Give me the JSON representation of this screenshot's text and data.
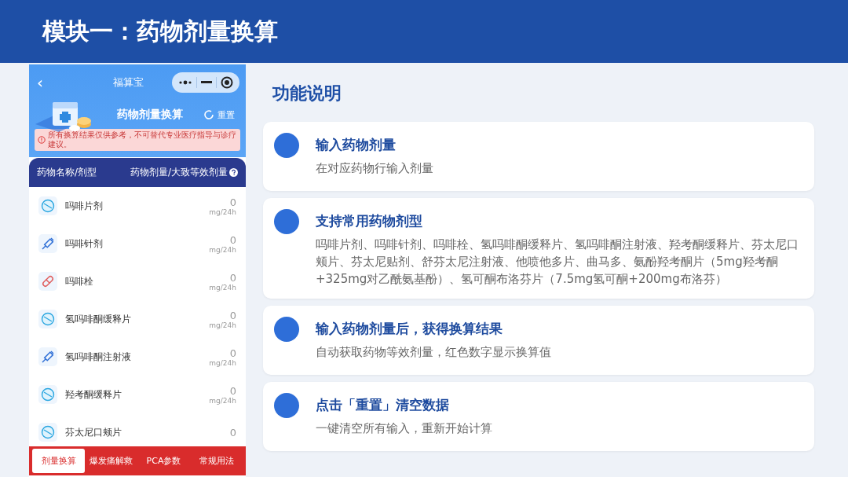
{
  "header": {
    "title": "模块一：药物剂量换算"
  },
  "phone": {
    "nav_title": "福算宝",
    "nav_back": "‹",
    "app_title": "药物剂量换算",
    "reset": "重置",
    "warning": "所有换算结果仅供参考，不可替代专业医疗指导与诊疗建议。",
    "columns": [
      "药物名称/剂型",
      "药物剂量/大致等效剂量"
    ],
    "rows": [
      {
        "kind": "tablet",
        "name": "吗啡片剂",
        "value": "0",
        "unit": "mg/24h"
      },
      {
        "kind": "injection",
        "name": "吗啡针剂",
        "value": "0",
        "unit": "mg/24h"
      },
      {
        "kind": "capsule",
        "name": "吗啡栓",
        "value": "0",
        "unit": "mg/24h"
      },
      {
        "kind": "tablet",
        "name": "氢吗啡酮缓释片",
        "value": "0",
        "unit": "mg/24h"
      },
      {
        "kind": "injection",
        "name": "氢吗啡酮注射液",
        "value": "0",
        "unit": "mg/24h"
      },
      {
        "kind": "tablet",
        "name": "羟考酮缓释片",
        "value": "0",
        "unit": "mg/24h"
      },
      {
        "kind": "tablet",
        "name": "芬太尼口颊片",
        "value": "0"
      }
    ],
    "tabs": [
      {
        "label": "剂量换算",
        "selected": true
      },
      {
        "label": "爆发痛解救",
        "selected": false
      },
      {
        "label": "PCA参数",
        "selected": false
      },
      {
        "label": "常规用法",
        "selected": false
      }
    ]
  },
  "features": {
    "title": "功能说明",
    "items": [
      {
        "title": "输入药物剂量",
        "text": "在对应药物行输入剂量"
      },
      {
        "title": "支持常用药物剂型",
        "text": "吗啡片剂、吗啡针剂、吗啡栓、氢吗啡酮缓释片、氢吗啡酮注射液、羟考酮缓释片、芬太尼口颊片、芬太尼贴剂、舒芬太尼注射液、他喷他多片、曲马多、氨酚羟考酮片（5mg羟考酮+325mg对乙酰氨基酚）、氢可酮布洛芬片（7.5mg氢可酮+200mg布洛芬）"
      },
      {
        "title": "输入药物剂量后，获得换算结果",
        "text": "自动获取药物等效剂量，红色数字显示换算值"
      },
      {
        "title": "点击「重置」清空数据",
        "text": "一键清空所有输入，重新开始计算"
      }
    ]
  }
}
